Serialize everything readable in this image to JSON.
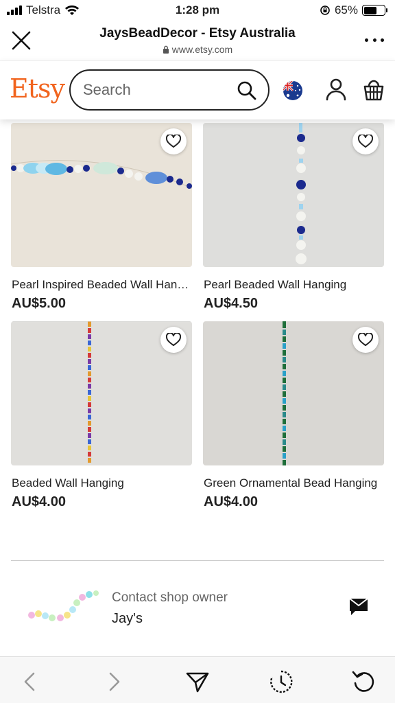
{
  "status_bar": {
    "carrier": "Telstra",
    "time": "1:28 pm",
    "battery_percent": "65%",
    "battery_level": 0.65
  },
  "browser": {
    "title": "JaysBeadDecor - Etsy Australia",
    "url": "www.etsy.com"
  },
  "etsy_header": {
    "logo": "Etsy",
    "search_placeholder": "Search",
    "brand_color": "#f1641e"
  },
  "listings": [
    {
      "title": "Pearl Inspired Beaded Wall Hanging",
      "price": "AU$5.00"
    },
    {
      "title": "Pearl Beaded Wall Hanging",
      "price": "AU$4.50"
    },
    {
      "title": "Beaded Wall Hanging",
      "price": "AU$4.00"
    },
    {
      "title": "Green Ornamental Bead Hanging",
      "price": "AU$4.00"
    }
  ],
  "contact": {
    "label": "Contact shop owner",
    "shop_name": "Jay's"
  },
  "icons": {
    "close": "close-icon",
    "more": "more-icon",
    "search": "search-icon",
    "flag": "australia-flag-icon",
    "user": "user-icon",
    "cart": "basket-icon",
    "favorite": "heart-icon",
    "message": "message-icon",
    "back": "chevron-left-icon",
    "forward": "chevron-right-icon",
    "share": "send-icon",
    "history": "history-icon",
    "reload": "reload-icon"
  }
}
